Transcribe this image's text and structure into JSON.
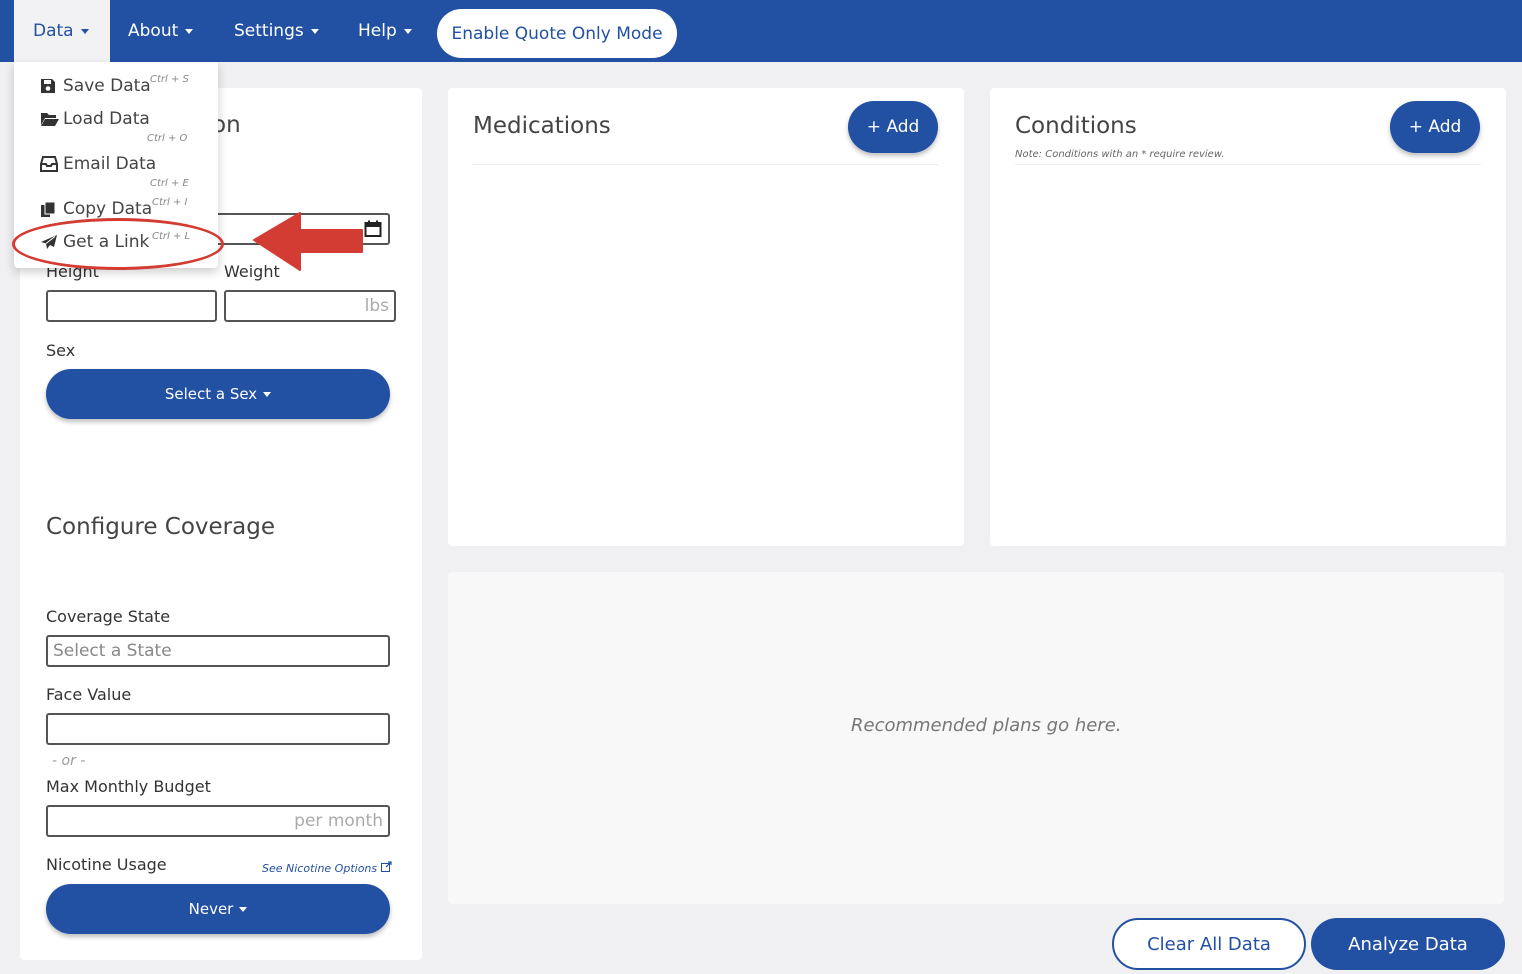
{
  "nav": {
    "items": [
      {
        "label": "Data"
      },
      {
        "label": "About"
      },
      {
        "label": "Settings"
      },
      {
        "label": "Help"
      }
    ],
    "quote_mode_label": "Enable Quote Only Mode"
  },
  "data_menu": {
    "items": [
      {
        "label": "Save Data",
        "shortcut": "Ctrl + S",
        "icon": "floppy-disk-icon"
      },
      {
        "label": "Load Data",
        "shortcut": "Ctrl + O",
        "icon": "folder-open-icon"
      },
      {
        "label": "Email Data",
        "shortcut": "Ctrl + E",
        "icon": "inbox-icon"
      },
      {
        "label": "Copy Data",
        "shortcut": "Ctrl + I",
        "icon": "copy-icon"
      },
      {
        "label": "Get a Link",
        "shortcut": "Ctrl + L",
        "icon": "paper-plane-icon"
      }
    ]
  },
  "applicant": {
    "heading_partial": "on",
    "height_label": "Height",
    "weight_label": "Weight",
    "weight_unit": "lbs",
    "sex_label": "Sex",
    "sex_button": "Select a Sex"
  },
  "coverage": {
    "title": "Configure Coverage",
    "state_label": "Coverage State",
    "state_placeholder": "Select a State",
    "face_value_label": "Face Value",
    "or_text": "- or -",
    "budget_label": "Max Monthly Budget",
    "budget_placeholder": "per month",
    "nicotine_label": "Nicotine Usage",
    "nicotine_link": "See Nicotine Options",
    "nicotine_button": "Never"
  },
  "medications": {
    "title": "Medications",
    "add_label": "+ Add"
  },
  "conditions": {
    "title": "Conditions",
    "add_label": "+ Add",
    "note": "Note: Conditions with an * require review."
  },
  "recommendations": {
    "placeholder": "Recommended plans go here."
  },
  "actions": {
    "clear_label": "Clear All Data",
    "analyze_label": "Analyze Data"
  },
  "colors": {
    "brand": "#2250a3",
    "annotation": "#d23c32"
  }
}
